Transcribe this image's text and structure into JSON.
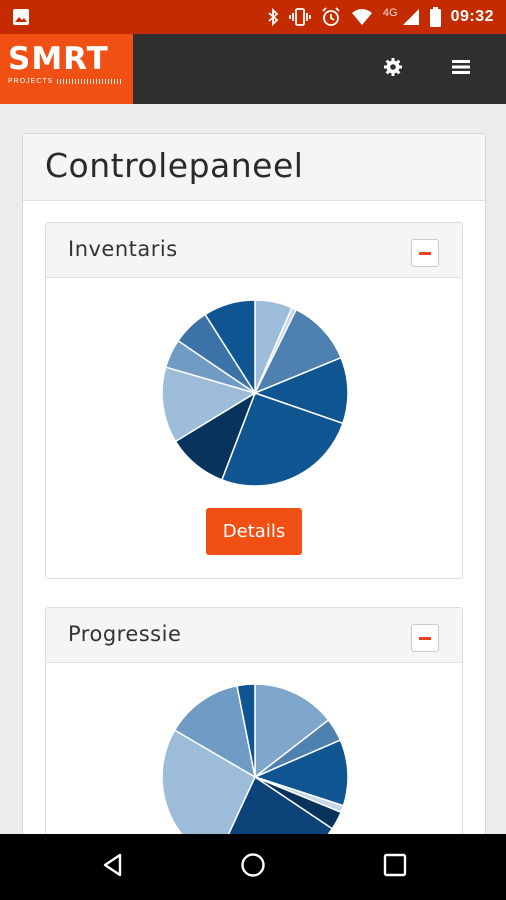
{
  "status_bar": {
    "network": "4G",
    "time": "09:32",
    "icons": [
      "image-icon",
      "bluetooth-icon",
      "vibrate-icon",
      "alarm-icon",
      "wifi-icon",
      "signal-icon",
      "battery-icon"
    ]
  },
  "app_bar": {
    "logo_text": "SMRT",
    "logo_subtext": "PROJECTS",
    "brand_color": "#f05014",
    "icons": [
      "gear-icon",
      "hamburger-menu-icon"
    ]
  },
  "page": {
    "title": "Controlepaneel"
  },
  "cards": [
    {
      "title": "Inventaris",
      "button_label": "Details",
      "chart_data": {
        "type": "pie",
        "slices": [
          {
            "value": 6.5,
            "color": "#9dbcd9"
          },
          {
            "value": 0.8,
            "color": "#c3d6ea"
          },
          {
            "value": 11.5,
            "color": "#4e80b0"
          },
          {
            "value": 11.5,
            "color": "#0f5592"
          },
          {
            "value": 25.5,
            "color": "#0f5592"
          },
          {
            "value": 10.5,
            "color": "#08335c"
          },
          {
            "value": 13.2,
            "color": "#9dbcd9"
          },
          {
            "value": 5.0,
            "color": "#6f9bc4"
          },
          {
            "value": 6.5,
            "color": "#3b73a8"
          },
          {
            "value": 9.0,
            "color": "#0f5592"
          }
        ]
      }
    },
    {
      "title": "Progressie",
      "chart_data": {
        "type": "pie",
        "slices": [
          {
            "value": 14.5,
            "color": "#7ea7cb"
          },
          {
            "value": 4.0,
            "color": "#4e80b0"
          },
          {
            "value": 11.5,
            "color": "#0f5592"
          },
          {
            "value": 1.2,
            "color": "#c3d6ea"
          },
          {
            "value": 3.2,
            "color": "#08335c"
          },
          {
            "value": 22.5,
            "color": "#0c447a"
          },
          {
            "value": 26.5,
            "color": "#9dbcd9"
          },
          {
            "value": 13.5,
            "color": "#6f9bc4"
          },
          {
            "value": 3.1,
            "color": "#0f5592"
          }
        ]
      }
    }
  ],
  "nav_bar": {
    "icons": [
      "back-icon",
      "home-icon",
      "recents-icon"
    ]
  }
}
